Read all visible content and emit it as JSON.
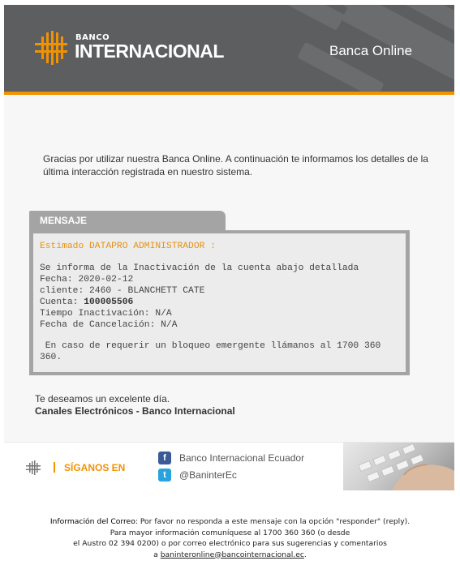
{
  "header": {
    "logo_banco": "BANCO",
    "logo_internacional": "INTERNACIONAL",
    "banca_online": "Banca Online"
  },
  "intro": "Gracias por utilizar nuestra Banca Online. A continuación te informamos los detalles de la última interacción registrada en nuestro sistema.",
  "message": {
    "tab_label": "MENSAJE",
    "greeting": "Estimado DATAPRO ADMINISTRADOR :",
    "line1": "Se informa de la Inactivación de la cuenta abajo detallada",
    "fecha": "Fecha: 2020-02-12",
    "cliente": "cliente: 2460 - BLANCHETT CATE",
    "cuenta_label": "Cuenta: ",
    "cuenta_value": "100005506",
    "tiempo": "Tiempo Inactivación: N/A",
    "cancelacion": "Fecha de Cancelación: N/A",
    "bloqueo": " En caso de requerir un bloqueo emergente llámanos al 1700 360 360."
  },
  "closing": {
    "line1": "Te deseamos un excelente día.",
    "line2": "Canales Electrónicos - Banco Internacional"
  },
  "footer": {
    "siganos": "SÍGANOS EN",
    "facebook_label": "Banco Internacional Ecuador",
    "twitter_label": "@BaninterEc",
    "facebook_icon": "f",
    "twitter_icon": "t"
  },
  "info": {
    "label": "Información del Correo",
    "line1_rest": ": Por favor no responda a este mensaje con la opción \"responder\" (reply).",
    "line2": "Para mayor información comuníquese al 1700 360 360 (o desde",
    "line3": "el Austro 02 394 0200) o por correo electrónico para sus sugerencias y comentarios",
    "line4_prefix": "a ",
    "email": "baninteronline@bancointernacional.ec",
    "line4_suffix": "."
  },
  "colors": {
    "accent": "#f39200",
    "header_bg": "#5d5e60",
    "tab_bg": "#a4a4a4"
  }
}
